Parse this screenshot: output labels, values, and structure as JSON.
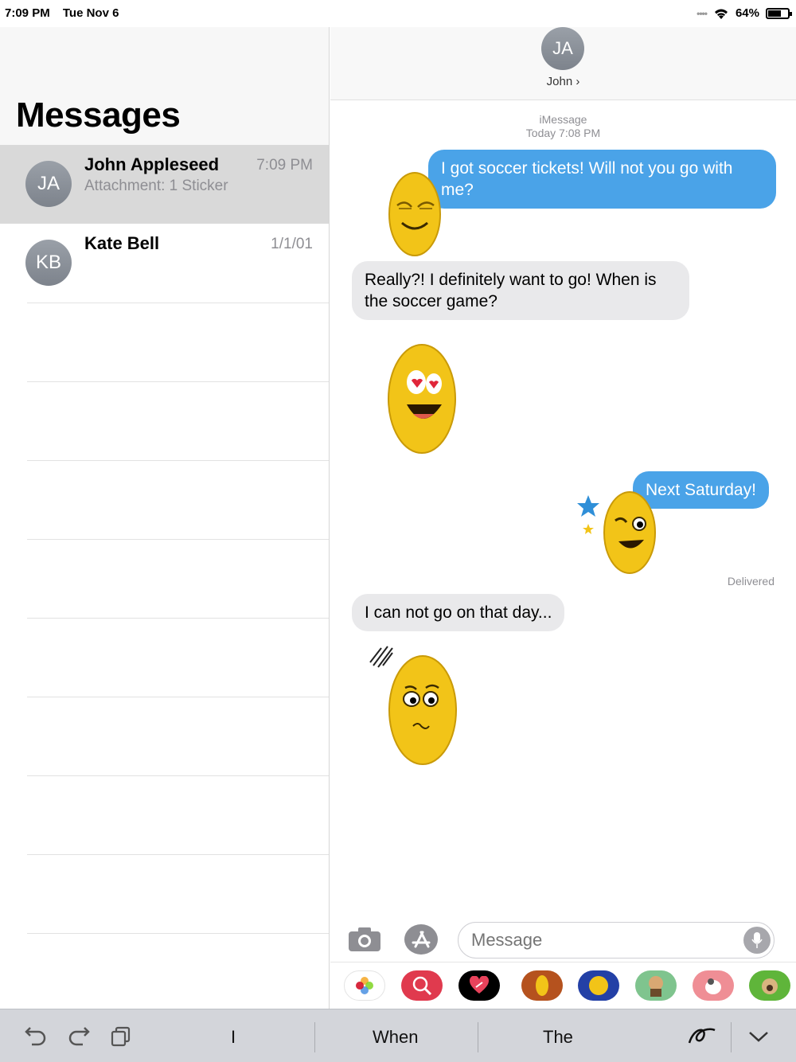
{
  "status": {
    "time": "7:09 PM",
    "date": "Tue Nov 6",
    "battery": "64%"
  },
  "sidebar": {
    "title": "Messages",
    "conversations": [
      {
        "initials": "JA",
        "name": "John Appleseed",
        "preview": "Attachment: 1 Sticker",
        "time": "7:09 PM"
      },
      {
        "initials": "KB",
        "name": "Kate Bell",
        "preview": "",
        "time": "1/1/01"
      }
    ]
  },
  "chat": {
    "contact_initials": "JA",
    "contact_name": "John ›",
    "service": "iMessage",
    "timestamp": "Today 7:08 PM",
    "messages": [
      {
        "from": "me",
        "text": "I got soccer tickets! Will not you go with me?"
      },
      {
        "from": "them",
        "text": "Really?! I definitely want to go! When is the soccer game?"
      },
      {
        "from": "me",
        "text": "Next Saturday!"
      },
      {
        "from": "them",
        "text": "I can not go on that day..."
      }
    ],
    "delivered": "Delivered",
    "input_placeholder": "Message"
  },
  "keyboard": {
    "suggestions": [
      "I",
      "When",
      "The"
    ]
  },
  "colors": {
    "bubble_out": "#4aa3e8",
    "bubble_in": "#e9e9eb",
    "accent": "#1a73e8"
  }
}
